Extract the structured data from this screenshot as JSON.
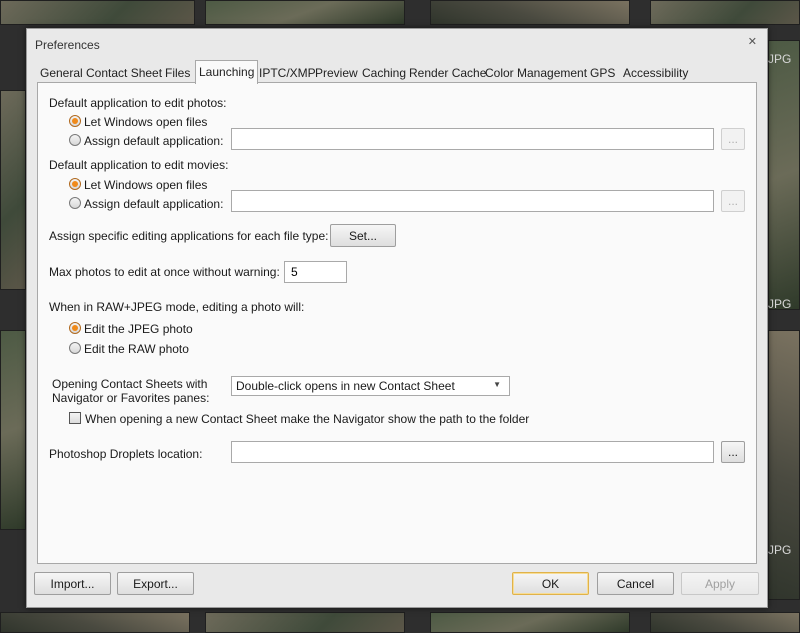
{
  "background": {
    "thumb_labels": [
      "JPG",
      "JPG",
      "JPG"
    ]
  },
  "dialog": {
    "title": "Preferences",
    "close_glyph": "✕"
  },
  "tabs": [
    "General",
    "Contact Sheet",
    "Files",
    "Launching",
    "IPTC/XMP",
    "Preview",
    "Caching",
    "Render Cache",
    "Color Management",
    "GPS",
    "Accessibility"
  ],
  "active_tab": "Launching",
  "launching": {
    "photos_heading": "Default application to edit photos:",
    "photos_opt_windows": "Let Windows open files",
    "photos_opt_assign": "Assign default application:",
    "photos_path_value": "",
    "movies_heading": "Default application to edit movies:",
    "movies_opt_windows": "Let Windows open files",
    "movies_opt_assign": "Assign default application:",
    "movies_path_value": "",
    "browse_ellipsis": "...",
    "filetype_label": "Assign specific editing applications for each file type:",
    "set_button": "Set...",
    "max_photos_label": "Max photos to edit at once without warning:",
    "max_photos_value": "5",
    "rawjpeg_heading": "When in RAW+JPEG mode, editing a photo will:",
    "rawjpeg_opt_jpeg": "Edit the JPEG photo",
    "rawjpeg_opt_raw": "Edit the RAW photo",
    "contact_label_line1": "Opening Contact Sheets with",
    "contact_label_line2": "Navigator or Favorites panes:",
    "contact_select_value": "Double-click opens in new Contact Sheet",
    "navigator_checkbox_label": "When opening a new Contact Sheet make the Navigator show the path to the folder",
    "droplets_label": "Photoshop Droplets location:",
    "droplets_value": ""
  },
  "footer": {
    "import": "Import...",
    "export": "Export...",
    "ok": "OK",
    "cancel": "Cancel",
    "apply": "Apply"
  },
  "colors": {
    "radio_selected": "#f08a1a",
    "default_button_border": "#e0b24a"
  }
}
